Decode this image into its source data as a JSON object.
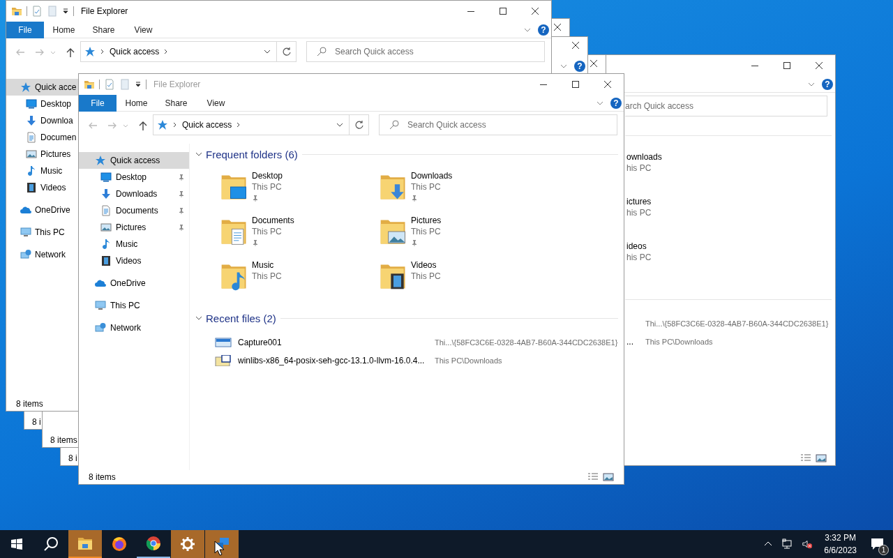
{
  "windows": [
    {
      "kind": "right",
      "help": "?",
      "search_placeholder": "arch Quick access",
      "folders": [
        {
          "name": "ownloads",
          "location": "his PC"
        },
        {
          "name": "ictures",
          "location": "his PC"
        },
        {
          "name": "ideos",
          "location": "his PC"
        }
      ],
      "recent": [
        {
          "path": "Thi...\\{58FC3C6E-0328-4AB7-B60A-344CDC2638E1}"
        },
        {
          "name": "...",
          "path": "This PC\\Downloads"
        }
      ]
    },
    {
      "kind": "edge-title",
      "status": "8 i"
    },
    {
      "kind": "edge-title",
      "status": "8 i"
    },
    {
      "kind": "edge-ribbon",
      "help": "?",
      "status": "8 items"
    },
    {
      "kind": "covered",
      "active": true,
      "title": "File Explorer",
      "help": "?",
      "ribbon": [
        {
          "label": "File",
          "kind": "file"
        },
        {
          "label": "Home",
          "kind": "tab"
        },
        {
          "label": "Share",
          "kind": "tab"
        },
        {
          "label": "View",
          "kind": "tab"
        }
      ],
      "address": "Quick access",
      "search_placeholder": "Search Quick access",
      "sidebar": [
        {
          "label": "Quick acce",
          "kind": "star",
          "selected": true,
          "children": [
            {
              "label": "Desktop",
              "kind": "desktop",
              "selected": false
            },
            {
              "label": "Downloa",
              "kind": "downloads",
              "selected": false
            },
            {
              "label": "Documen",
              "kind": "documents",
              "selected": false
            },
            {
              "label": "Pictures",
              "kind": "pictures",
              "selected": false
            },
            {
              "label": "Music",
              "kind": "music",
              "selected": false
            },
            {
              "label": "Videos",
              "kind": "videos",
              "selected": false
            }
          ]
        },
        {
          "label": "OneDrive",
          "kind": "onedrive",
          "selected": false
        },
        {
          "label": "This PC",
          "kind": "pc",
          "selected": false
        },
        {
          "label": "Network",
          "kind": "network",
          "selected": false
        }
      ],
      "status": "8 items"
    },
    {
      "kind": "full",
      "active": false,
      "title": "File Explorer",
      "help": "?",
      "ribbon": [
        {
          "label": "File",
          "kind": "file"
        },
        {
          "label": "Home",
          "kind": "tab"
        },
        {
          "label": "Share",
          "kind": "tab"
        },
        {
          "label": "View",
          "kind": "tab"
        }
      ],
      "address": "Quick access",
      "search_placeholder": "Search Quick access",
      "sidebar": [
        {
          "label": "Quick access",
          "kind": "star",
          "selected": true,
          "children": [
            {
              "label": "Desktop",
              "kind": "desktop",
              "selected": false,
              "pinned": true
            },
            {
              "label": "Downloads",
              "kind": "downloads",
              "selected": false,
              "pinned": true
            },
            {
              "label": "Documents",
              "kind": "documents",
              "selected": false,
              "pinned": true
            },
            {
              "label": "Pictures",
              "kind": "pictures",
              "selected": false,
              "pinned": true
            },
            {
              "label": "Music",
              "kind": "music",
              "selected": false,
              "pinned": false
            },
            {
              "label": "Videos",
              "kind": "videos",
              "selected": false,
              "pinned": false
            }
          ]
        },
        {
          "label": "OneDrive",
          "kind": "onedrive",
          "selected": false
        },
        {
          "label": "This PC",
          "kind": "pc",
          "selected": false
        },
        {
          "label": "Network",
          "kind": "network",
          "selected": false
        }
      ],
      "sections": [
        {
          "kind": "folders",
          "title": "Frequent folders (6)",
          "expanded": true,
          "items": [
            {
              "name": "Desktop",
              "location": "This PC",
              "kind": "desktop",
              "pinned": true
            },
            {
              "name": "Downloads",
              "location": "This PC",
              "kind": "downloads",
              "pinned": true
            },
            {
              "name": "Documents",
              "location": "This PC",
              "kind": "documents",
              "pinned": true
            },
            {
              "name": "Pictures",
              "location": "This PC",
              "kind": "pictures",
              "pinned": true
            },
            {
              "name": "Music",
              "location": "This PC",
              "kind": "music",
              "pinned": false
            },
            {
              "name": "Videos",
              "location": "This PC",
              "kind": "videos",
              "pinned": false
            }
          ]
        },
        {
          "kind": "recent",
          "title": "Recent files (2)",
          "expanded": true,
          "items": [
            {
              "name": "Capture001",
              "path": "Thi...\\{58FC3C6E-0328-4AB7-B60A-344CDC2638E1}",
              "kind": "image"
            },
            {
              "name": "winlibs-x86_64-posix-seh-gcc-13.1.0-llvm-16.0.4...",
              "path": "This PC\\Downloads",
              "kind": "archive"
            }
          ]
        }
      ],
      "status": "8 items"
    }
  ],
  "taskbar": {
    "apps": [
      {
        "kind": "folder",
        "flashing": true,
        "running": true
      },
      {
        "kind": "firefox",
        "flashing": false,
        "running": false
      },
      {
        "kind": "chrome",
        "flashing": false,
        "running": true
      },
      {
        "kind": "gear",
        "flashing": true,
        "running": false
      },
      {
        "kind": "app",
        "flashing": true,
        "running": false
      }
    ],
    "volume_muted": true,
    "time": "3:32 PM",
    "date": "6/6/2023",
    "notifications": "1"
  }
}
